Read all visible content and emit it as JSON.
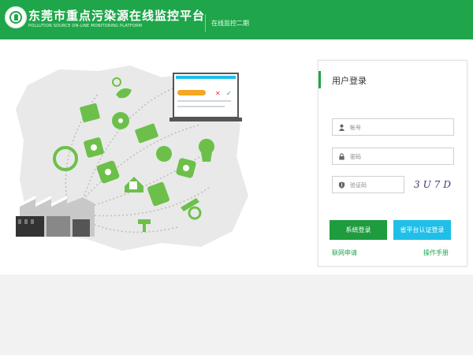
{
  "header": {
    "title_cn": "东莞市重点污染源在线监控平台",
    "title_en": "POLLUTION SOURCE ON-LINE MONITORING PLATFORM",
    "phase": "在线监控二期"
  },
  "login": {
    "title": "用户登录",
    "username_placeholder": "帐号",
    "password_placeholder": "密码",
    "captcha_placeholder": "验证码",
    "captcha_text": "3U7D",
    "login_button": "系统登录",
    "cert_button": "省平台认证登录",
    "apply_link": "联网申请",
    "manual_link": "操作手册"
  },
  "colors": {
    "brand_green": "#1fa64a",
    "login_button": "#1e9c3e",
    "cert_button": "#1fbfe8",
    "illustration_green": "#6cc04a"
  },
  "icons": [
    "logo-emblem-icon",
    "user-icon",
    "lock-icon",
    "shield-icon"
  ]
}
